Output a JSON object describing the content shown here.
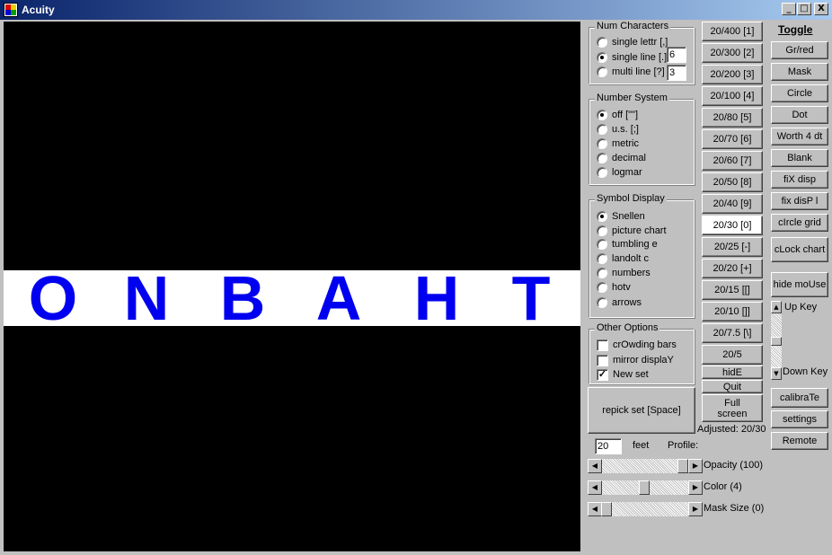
{
  "window": {
    "title": "Acuity",
    "minimize": "_",
    "maximize": "□",
    "close": "X"
  },
  "display": {
    "letters": [
      "O",
      "N",
      "B",
      "A",
      "H",
      "T"
    ],
    "letter_color": "#0000f0",
    "strip_color": "#ffffff",
    "background_color": "#000000"
  },
  "num_characters": {
    "legend": "Num Characters",
    "options": [
      {
        "label": "single lettr [,]",
        "selected": false
      },
      {
        "label": "single line [.]",
        "selected": true
      },
      {
        "label": "multi line [?]",
        "selected": false
      }
    ],
    "single_line_value": "6",
    "multi_line_value": "3"
  },
  "number_system": {
    "legend": "Number System",
    "options": [
      {
        "label": "off [\"\"]",
        "selected": true
      },
      {
        "label": "u.s. [;]",
        "selected": false
      },
      {
        "label": "metric",
        "selected": false
      },
      {
        "label": "decimal",
        "selected": false
      },
      {
        "label": "logmar",
        "selected": false
      }
    ]
  },
  "symbol_display": {
    "legend": "Symbol Display",
    "options": [
      {
        "label": "Snellen",
        "selected": true
      },
      {
        "label": "picture chart",
        "selected": false
      },
      {
        "label": "tumbling e",
        "selected": false
      },
      {
        "label": "landolt c",
        "selected": false
      },
      {
        "label": "numbers",
        "selected": false
      },
      {
        "label": "hotv",
        "selected": false
      },
      {
        "label": "arrows",
        "selected": false
      }
    ]
  },
  "other_options": {
    "legend": "Other Options",
    "options": [
      {
        "label": "crOwding bars",
        "checked": false
      },
      {
        "label": "mirror displaY",
        "checked": false
      },
      {
        "label": "New set",
        "checked": true
      }
    ],
    "check_mark": "✓"
  },
  "repick_button": "repick set [Space]",
  "distance": {
    "value": "20",
    "unit": "feet",
    "profile_label": "Profile:"
  },
  "sliders": [
    {
      "label": "Opacity (100)",
      "value": 100
    },
    {
      "label": "Color (4)",
      "value": 4
    },
    {
      "label": "Mask Size (0)",
      "value": 0
    }
  ],
  "acuity_buttons": [
    {
      "label": "20/400 [1]",
      "selected": false
    },
    {
      "label": "20/300 [2]",
      "selected": false
    },
    {
      "label": "20/200 [3]",
      "selected": false
    },
    {
      "label": "20/100 [4]",
      "selected": false
    },
    {
      "label": "20/80 [5]",
      "selected": false
    },
    {
      "label": "20/70 [6]",
      "selected": false
    },
    {
      "label": "20/60 [7]",
      "selected": false
    },
    {
      "label": "20/50 [8]",
      "selected": false
    },
    {
      "label": "20/40 [9]",
      "selected": false
    },
    {
      "label": "20/30 [0]",
      "selected": true
    },
    {
      "label": "20/25 [-]",
      "selected": false
    },
    {
      "label": "20/20 [+]",
      "selected": false
    },
    {
      "label": "20/15 [[]",
      "selected": false
    },
    {
      "label": "20/10 []]",
      "selected": false
    },
    {
      "label": "20/7.5 [\\]",
      "selected": false
    },
    {
      "label": "20/5",
      "selected": false
    }
  ],
  "action_buttons": {
    "hide": "hidE",
    "quit": "Quit",
    "full_screen_line1": "Full",
    "full_screen_line2": "screen"
  },
  "adjusted_text": "Adjusted: 20/30",
  "toggle": {
    "title": "Toggle",
    "buttons": [
      "Gr/red",
      "Mask",
      "Circle",
      "Dot",
      "Worth 4 dt",
      "Blank",
      "fiX disp",
      "fix disP l",
      "cIrcle grid",
      "cLock chart",
      "hide moUse"
    ],
    "up_key": "Up Key",
    "down_key": "Down Key",
    "bottom_buttons": [
      "calibraTe",
      "settings",
      "Remote"
    ]
  }
}
